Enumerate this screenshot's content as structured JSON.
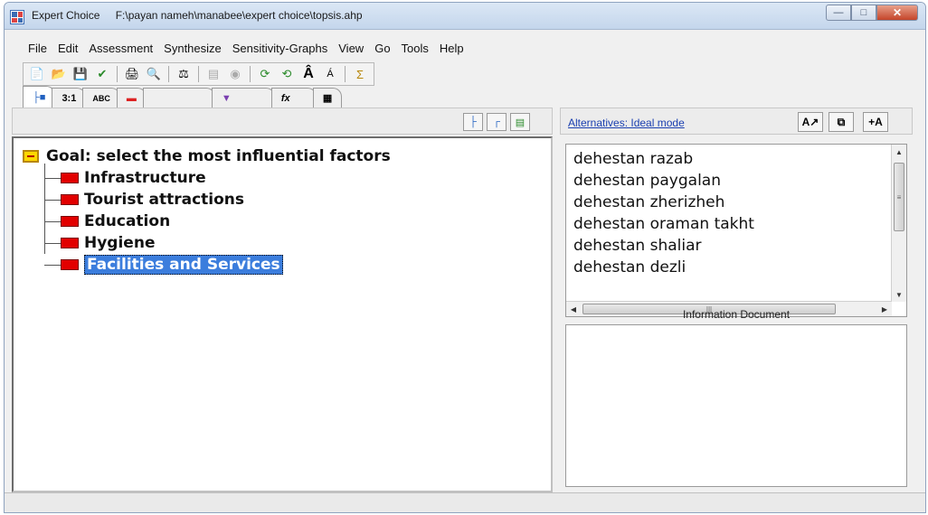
{
  "window": {
    "app_name": "Expert Choice",
    "file_path": "F:\\payan nameh\\manabee\\expert choice\\topsis.ahp"
  },
  "menu": [
    "File",
    "Edit",
    "Assessment",
    "Synthesize",
    "Sensitivity-Graphs",
    "View",
    "Go",
    "Tools",
    "Help"
  ],
  "tabs": [
    {
      "label": "",
      "icon": "tree-icon"
    },
    {
      "label": "3:1"
    },
    {
      "label": "ABC"
    },
    {
      "label": "",
      "icon": "bar-icon"
    },
    {
      "label": "",
      "icon": "blank"
    },
    {
      "label": "",
      "icon": "funnel-icon"
    },
    {
      "label": "",
      "icon": "formula-icon"
    },
    {
      "label": "",
      "icon": "grid-icon"
    }
  ],
  "tree": {
    "goal": "Goal: select the most influential factors",
    "children": [
      "Infrastructure",
      "Tourist attractions",
      "Education",
      "Hygiene",
      "Facilities and Services"
    ],
    "selected_index": 4
  },
  "alternatives": {
    "header": "Alternatives: Ideal mode",
    "items": [
      "dehestan razab",
      "dehestan paygalan",
      "dehestan zherizheh",
      "dehestan oraman takht",
      "dehestan shaliar",
      "dehestan dezli"
    ]
  },
  "info_document_label": "Information Document",
  "colors": {
    "selection": "#3b7ddd",
    "node_red": "#e20000",
    "goal_yellow": "#ffd700",
    "link_blue": "#1a3fb0"
  }
}
